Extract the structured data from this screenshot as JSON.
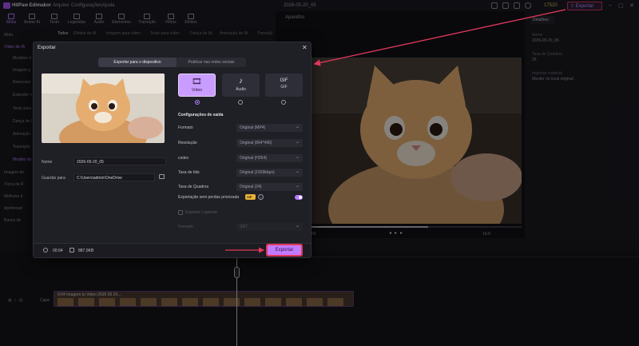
{
  "app": {
    "name": "HitPaw Edimakor",
    "menus": [
      "Arquivo",
      "Configurações",
      "Ajuda"
    ],
    "document_title": "2026-05-20_05",
    "credits": "17520",
    "export_label": "Exportar"
  },
  "toolbar": {
    "items": [
      {
        "label": "Mídia",
        "icon": "media-icon"
      },
      {
        "label": "Avatar AI",
        "icon": "avatar-icon"
      },
      {
        "label": "Texto",
        "icon": "text-icon"
      },
      {
        "label": "Legendas",
        "icon": "captions-icon"
      },
      {
        "label": "Áudio",
        "icon": "audio-icon"
      },
      {
        "label": "Elementos",
        "icon": "elements-icon"
      },
      {
        "label": "Transição",
        "icon": "transition-icon"
      },
      {
        "label": "Filtros",
        "icon": "filters-icon"
      },
      {
        "label": "Efeitos",
        "icon": "effects-icon"
      }
    ]
  },
  "subtabs": [
    "Todos",
    "Efeitos de IA",
    "Imagem para vídeo",
    "Texto para vídeo",
    "Dança de IA",
    "Animação de IA",
    "Transiçã"
  ],
  "sidebar": {
    "items": [
      "Mída",
      "Vídeo de IA",
      "Modelos d",
      "Imagem p",
      "Reescalar",
      "Estender v",
      "Texto para",
      "Dança de I",
      "Animação",
      "Transição",
      "Modelo do",
      "Imagem de",
      "Troca de R",
      "Melhoria d",
      "Aprimorad",
      "Banco de"
    ]
  },
  "preview": {
    "title": "Aparelho",
    "ratio": "16:9"
  },
  "properties": {
    "tab": "Detalhes",
    "fields": [
      {
        "label": "Nome",
        "value": "2026-05-20_05"
      },
      {
        "label": "Taxa de Quadros",
        "value": "25"
      },
      {
        "label": "Importar material",
        "value": "Manter no local original"
      }
    ]
  },
  "timeline": {
    "track_label": "Capa",
    "clip_label": "0:04 Imagem to Video 2026 05 20..."
  },
  "dialog": {
    "title": "Exportar",
    "tabs": [
      "Exportar para o dispositivo",
      "Publicar nas redes sociais"
    ],
    "name_label": "Nome",
    "name_value": "2026-05-20_05",
    "save_label": "Guardar para",
    "save_value": "C:\\Users\\admin\\OneDrive",
    "formats": [
      {
        "label": "Vídeo",
        "glyph": "🎞"
      },
      {
        "label": "Áudio",
        "glyph": "♪"
      },
      {
        "label": "GIF",
        "glyph": "GIF"
      }
    ],
    "config_title": "Configurações de saída",
    "settings": [
      {
        "label": "Formato",
        "value": "Original (MP4)"
      },
      {
        "label": "Resolução",
        "value": "Original (864*496)"
      },
      {
        "label": "codec",
        "value": "Original (H264)"
      },
      {
        "label": "Taxa de bits",
        "value": "Original (1659kbps)"
      },
      {
        "label": "Taxa de Quadros",
        "value": "Original (24)"
      }
    ],
    "lossless_label": "Exportação sem perdas priorizada",
    "vip_badge": "VIP",
    "subtitle_label": "Exportar Legenda",
    "format2_label": "Formato",
    "format2_value": "SRT",
    "duration": "00:04",
    "size": "887.0KB",
    "export_button": "Exportar"
  },
  "colors": {
    "accent": "#b57cff",
    "annotation": "#e0385a",
    "background": "#16161b"
  }
}
